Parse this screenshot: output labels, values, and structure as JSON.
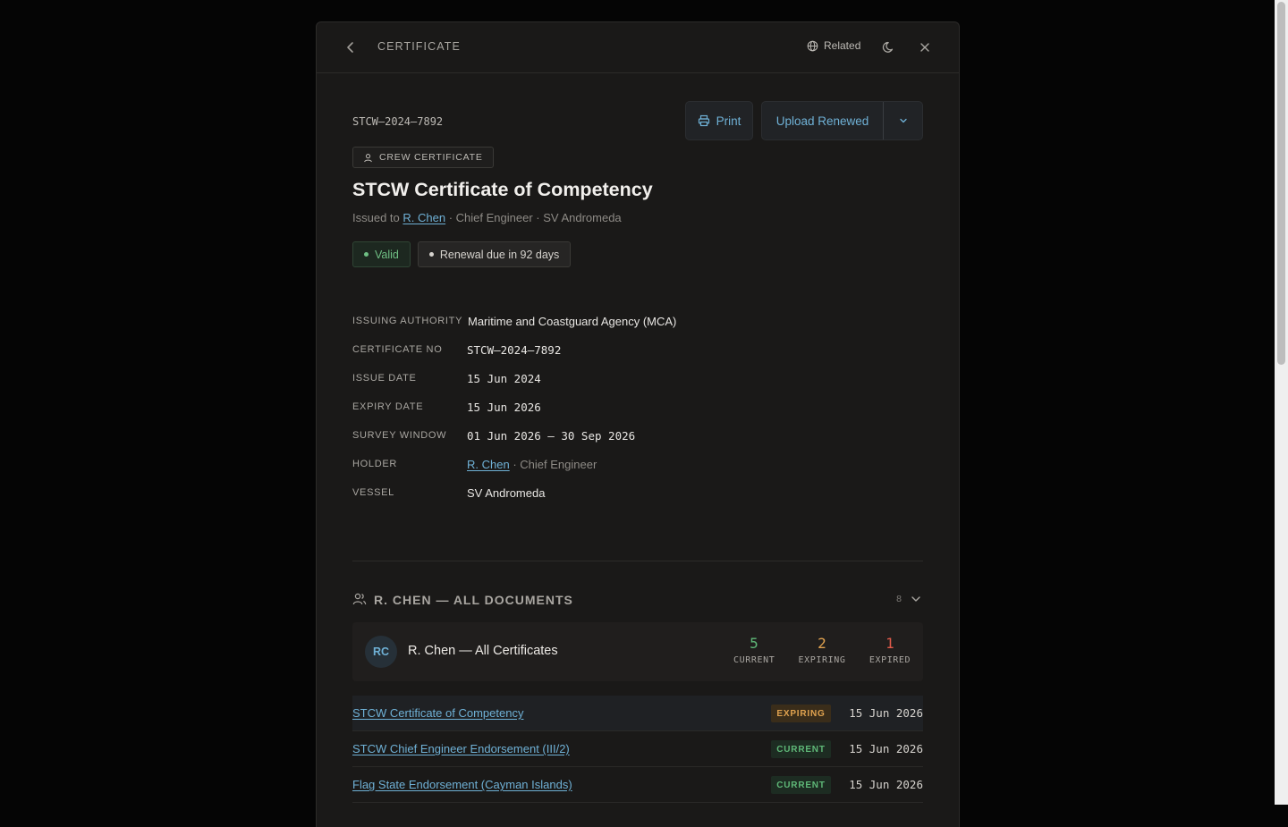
{
  "header": {
    "title": "CERTIFICATE",
    "related_label": "Related"
  },
  "certificate": {
    "code": "STCW–2024–7892",
    "type_badge": "CREW CERTIFICATE",
    "title": "STCW Certificate of Competency",
    "issued_prefix": "Issued to",
    "holder_name": "R. Chen",
    "issued_suffix": "· Chief Engineer · SV Andromeda",
    "status_valid": "Valid",
    "status_renewal": "Renewal due in 92 days"
  },
  "actions": {
    "print_label": "Print",
    "upload_label": "Upload Renewed"
  },
  "fields": {
    "authority_label": "ISSUING AUTHORITY",
    "authority_value": "Maritime and Coastguard Agency (MCA)",
    "certno_label": "CERTIFICATE NO",
    "certno_value": "STCW–2024–7892",
    "issue_label": "ISSUE DATE",
    "issue_value": "15 Jun 2024",
    "expiry_label": "EXPIRY DATE",
    "expiry_value": "15 Jun 2026",
    "survey_label": "SURVEY WINDOW",
    "survey_value": "01 Jun 2026 — 30 Sep 2026",
    "holder_label": "HOLDER",
    "holder_value": "R. Chen",
    "holder_role": "· Chief Engineer",
    "vessel_label": "VESSEL",
    "vessel_value": "SV Andromeda"
  },
  "documents": {
    "section_title": "R. CHEN — ALL DOCUMENTS",
    "count": "8",
    "summary": {
      "initials": "RC",
      "name": "R. Chen — All Certificates",
      "current_count": "5",
      "current_label": "CURRENT",
      "expiring_count": "2",
      "expiring_label": "EXPIRING",
      "expired_count": "1",
      "expired_label": "EXPIRED"
    },
    "rows": [
      {
        "name": "STCW Certificate of Competency",
        "status": "EXPIRING",
        "date": "15 Jun 2026"
      },
      {
        "name": "STCW Chief Engineer Endorsement (III/2)",
        "status": "CURRENT",
        "date": "15 Jun 2026"
      },
      {
        "name": "Flag State Endorsement (Cayman Islands)",
        "status": "CURRENT",
        "date": "15 Jun 2026"
      }
    ]
  },
  "colors": {
    "accent": "#6fb1d6",
    "valid": "#6fbf84",
    "expiring": "#e0a24f",
    "expired": "#e05a4a",
    "current": "#5fb878"
  }
}
